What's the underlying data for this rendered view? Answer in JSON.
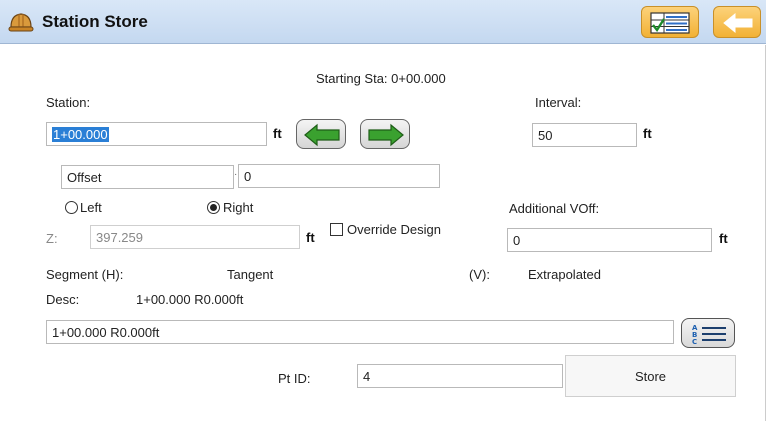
{
  "titlebar": {
    "title": "Station Store",
    "app_icon": "hardhat-icon",
    "view_button_icon": "grid-check-icon",
    "back_button_icon": "back-arrow-icon",
    "accent_color": "#f2b135"
  },
  "form": {
    "starting_sta": "Starting Sta: 0+00.000",
    "station_label": "Station:",
    "station_value": "1+00.000",
    "station_unit": "ft",
    "interval_label": "Interval:",
    "interval_value": "50",
    "interval_unit": "ft",
    "offset_select": "Offset",
    "offset_value": "0",
    "left_label": "Left",
    "right_label": "Right",
    "selected_side": "Right",
    "additional_voff_label": "Additional VOff:",
    "additional_voff_value": "0",
    "additional_voff_unit": "ft",
    "z_label": "Z:",
    "z_value": "397.259",
    "z_unit": "ft",
    "override_design_label": "Override Design",
    "override_design_checked": false,
    "segment_h_label": "Segment (H):",
    "segment_h_value": "Tangent",
    "segment_v_label": "(V):",
    "segment_v_value": "Extrapolated",
    "desc_label": "Desc:",
    "desc_display": "1+00.000 R0.000ft",
    "desc_value": "1+00.000 R0.000ft",
    "desc_button_icon": "abc-list-icon",
    "pt_id_label": "Pt ID:",
    "pt_id_value": "4",
    "store_label": "Store",
    "arrow_color": "#3aa12f"
  }
}
